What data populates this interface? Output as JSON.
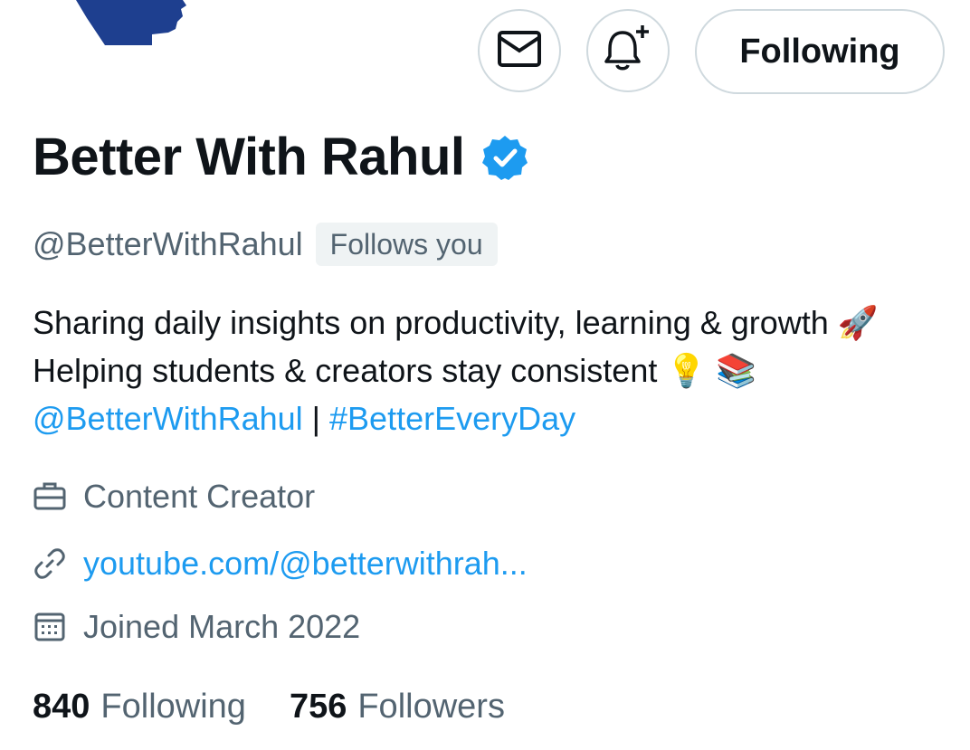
{
  "profile": {
    "display_name": "Better With Rahul",
    "handle": "@BetterWithRahul",
    "follows_you": "Follows you",
    "bio": {
      "text_1": "Sharing daily insights on productivity, learning & growth ",
      "emoji_1": "🚀",
      "text_2": " Helping students & creators stay consistent ",
      "emoji_2": "💡",
      "emoji_3": "📚",
      "mention": "@BetterWithRahul",
      "separator": " | ",
      "hashtag": "#BetterEveryDay"
    },
    "category": "Content Creator",
    "website": "youtube.com/@betterwithrah...",
    "joined": "Joined March 2022",
    "stats": {
      "following_count": "840",
      "following_label": "Following",
      "followers_count": "756",
      "followers_label": "Followers"
    }
  },
  "actions": {
    "message_icon": "envelope-icon",
    "notify_icon": "bell-plus-icon",
    "follow_label": "Following"
  },
  "colors": {
    "accent": "#1d9bf0",
    "text_primary": "#0f1419",
    "text_secondary": "#536471",
    "border": "#cfd9de",
    "avatar": "#1e3f8f"
  }
}
